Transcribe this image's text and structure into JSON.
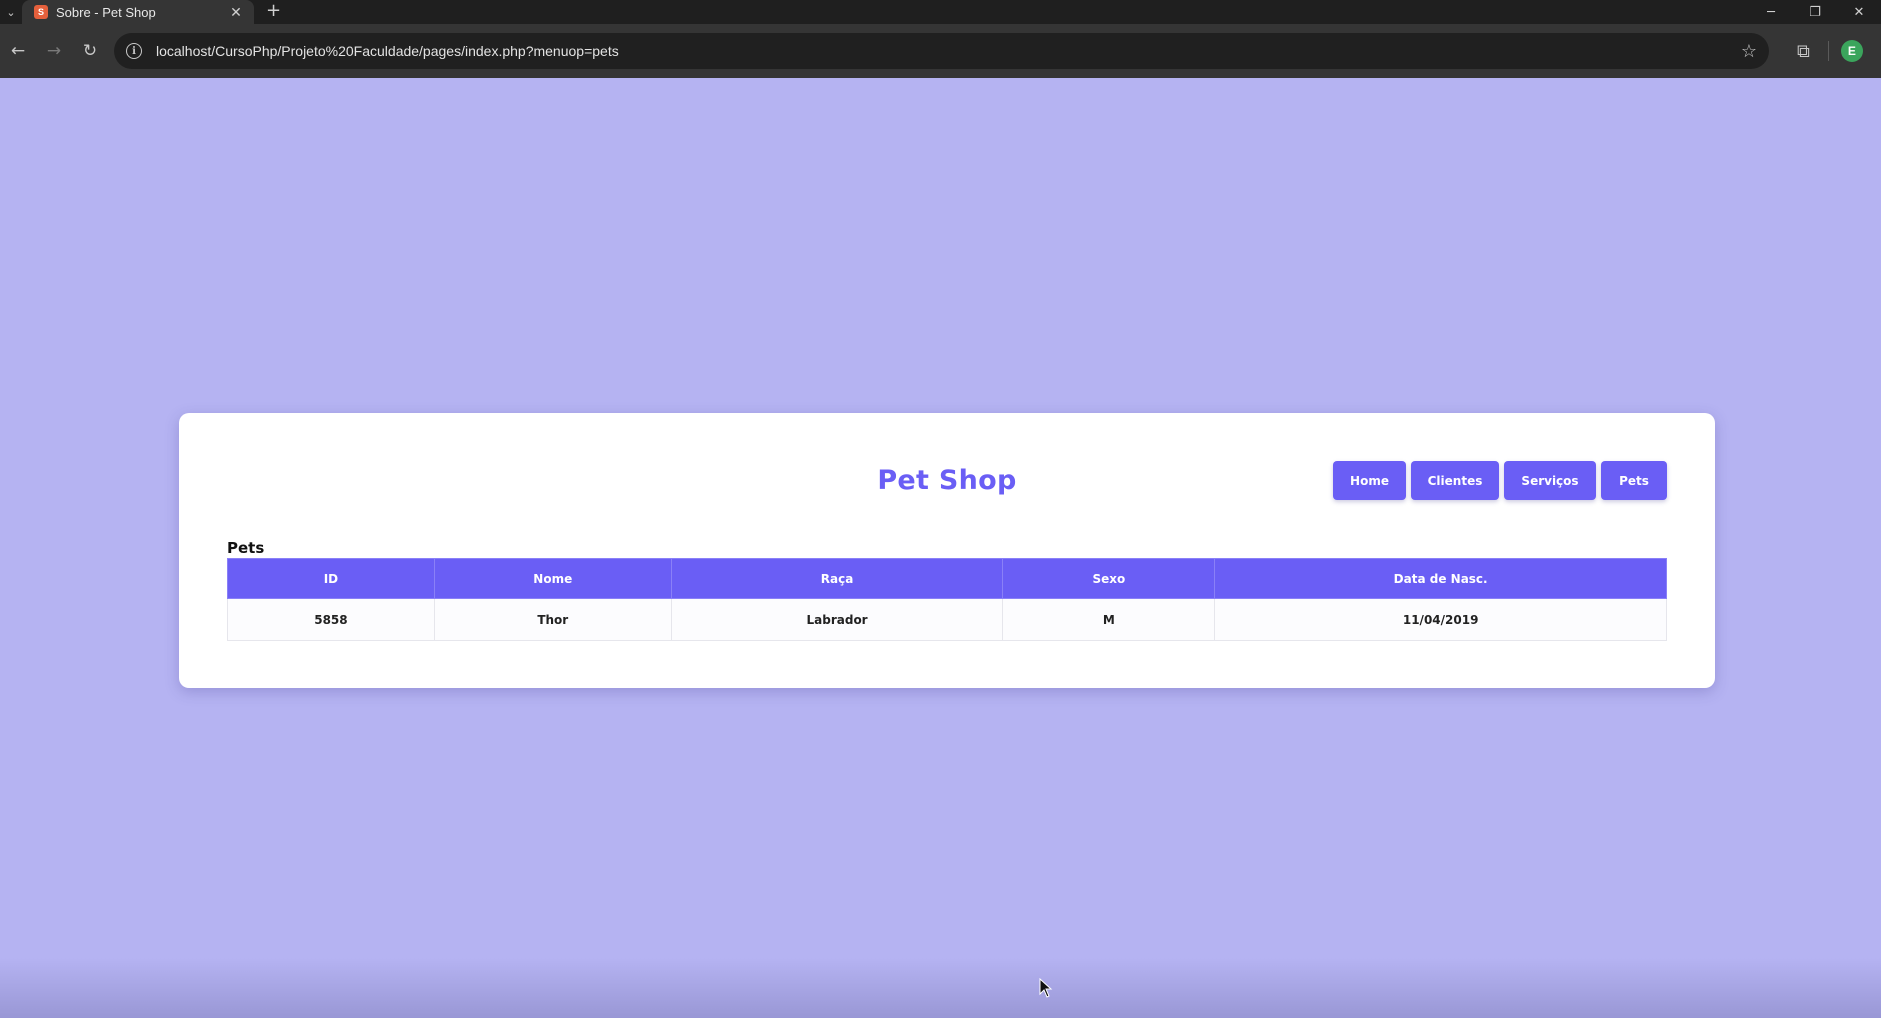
{
  "browser": {
    "tab_title": "Sobre - Pet Shop",
    "favicon_letter": "S",
    "url": "localhost/CursoPhp/Projeto%20Faculdade/pages/index.php?menuop=pets",
    "profile_initial": "E"
  },
  "site": {
    "brand": "Pet Shop",
    "menu": [
      {
        "label": "Home"
      },
      {
        "label": "Clientes"
      },
      {
        "label": "Serviços"
      },
      {
        "label": "Pets"
      }
    ]
  },
  "pets": {
    "title": "Pets",
    "columns": [
      "ID",
      "Nome",
      "Raça",
      "Sexo",
      "Data de Nasc."
    ],
    "rows": [
      [
        "5858",
        "Thor",
        "Labrador",
        "M",
        "11/04/2019"
      ]
    ]
  },
  "colors": {
    "accent": "#6a5ef5",
    "background": "#b5b3f2"
  }
}
